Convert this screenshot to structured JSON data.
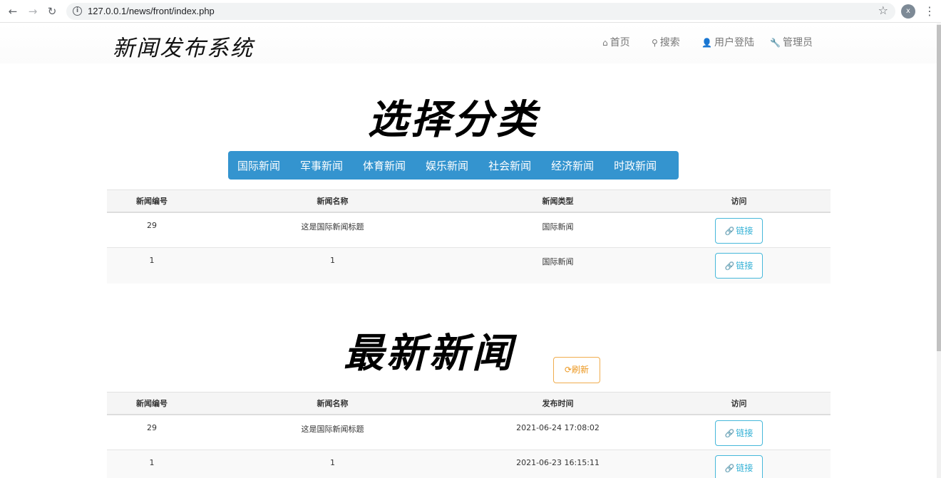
{
  "browser": {
    "back_icon": "←",
    "forward_icon": "→",
    "reload_icon": "↻",
    "info_icon": "i",
    "url": "127.0.0.1/news/front/index.php",
    "star_icon": "☆",
    "profile_initial": "x",
    "menu_icon": "⋮"
  },
  "header": {
    "logo": "新闻发布系统",
    "nav": [
      {
        "icon": "⌂",
        "label": "首页"
      },
      {
        "icon": "⚲",
        "label": "搜索"
      },
      {
        "icon": "👤",
        "label": "用户登陆"
      },
      {
        "icon": "🔧",
        "label": "管理员"
      }
    ]
  },
  "categories": {
    "title": "选择分类",
    "items": [
      "国际新闻",
      "军事新闻",
      "体育新闻",
      "娱乐新闻",
      "社会新闻",
      "经济新闻",
      "时政新闻"
    ],
    "columns": [
      "新闻编号",
      "新闻名称",
      "新闻类型",
      "访问"
    ],
    "rows": [
      {
        "id": "29",
        "name": "这是国际新闻标题",
        "type": "国际新闻",
        "action": "链接"
      },
      {
        "id": "1",
        "name": "1",
        "type": "国际新闻",
        "action": "链接"
      }
    ]
  },
  "latest": {
    "title": "最新新闻",
    "refresh_label": "刷新",
    "refresh_icon": "⟳",
    "columns": [
      "新闻编号",
      "新闻名称",
      "发布时间",
      "访问"
    ],
    "rows": [
      {
        "id": "29",
        "name": "这是国际新闻标题",
        "time": "2021-06-24 17:08:02",
        "action": "链接"
      },
      {
        "id": "1",
        "name": "1",
        "time": "2021-06-23 16:15:11",
        "action": "链接"
      }
    ]
  },
  "link_icon": "🔗",
  "colors": {
    "category_bar": "#3494cf",
    "link_button": "#46b8da",
    "refresh_button": "#f0ad4e"
  }
}
